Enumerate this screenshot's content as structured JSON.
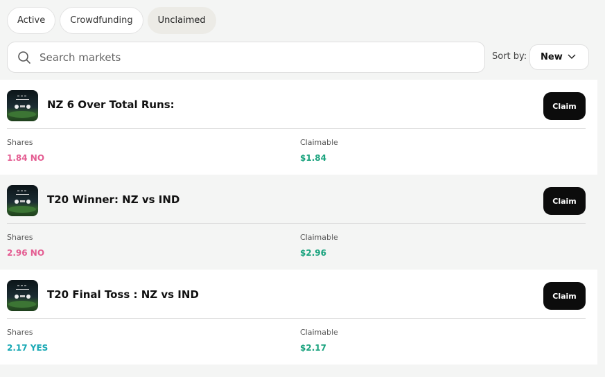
{
  "tabs": [
    {
      "label": "Active"
    },
    {
      "label": "Crowdfunding"
    },
    {
      "label": "Unclaimed"
    }
  ],
  "search": {
    "placeholder": "Search markets"
  },
  "sort": {
    "label": "Sort by:",
    "value": "New"
  },
  "markets": [
    {
      "title": "NZ 6 Over Total Runs:",
      "claim_label": "Claim",
      "shares_label": "Shares",
      "shares_value": "1.84 NO",
      "claimable_label": "Claimable",
      "claimable_value": "$1.84"
    },
    {
      "title": "T20 Winner: NZ vs IND",
      "claim_label": "Claim",
      "shares_label": "Shares",
      "shares_value": "2.96 NO",
      "claimable_label": "Claimable",
      "claimable_value": "$2.96"
    },
    {
      "title": "T20 Final Toss : NZ vs IND",
      "claim_label": "Claim",
      "shares_label": "Shares",
      "shares_value": "2.17 YES",
      "claimable_label": "Claimable",
      "claimable_value": "$2.17"
    }
  ],
  "colors": {
    "no": "#e45d92",
    "yes": "#17a8b4",
    "claimable": "#1aa37e",
    "claim_button": "#0c0c0c"
  }
}
